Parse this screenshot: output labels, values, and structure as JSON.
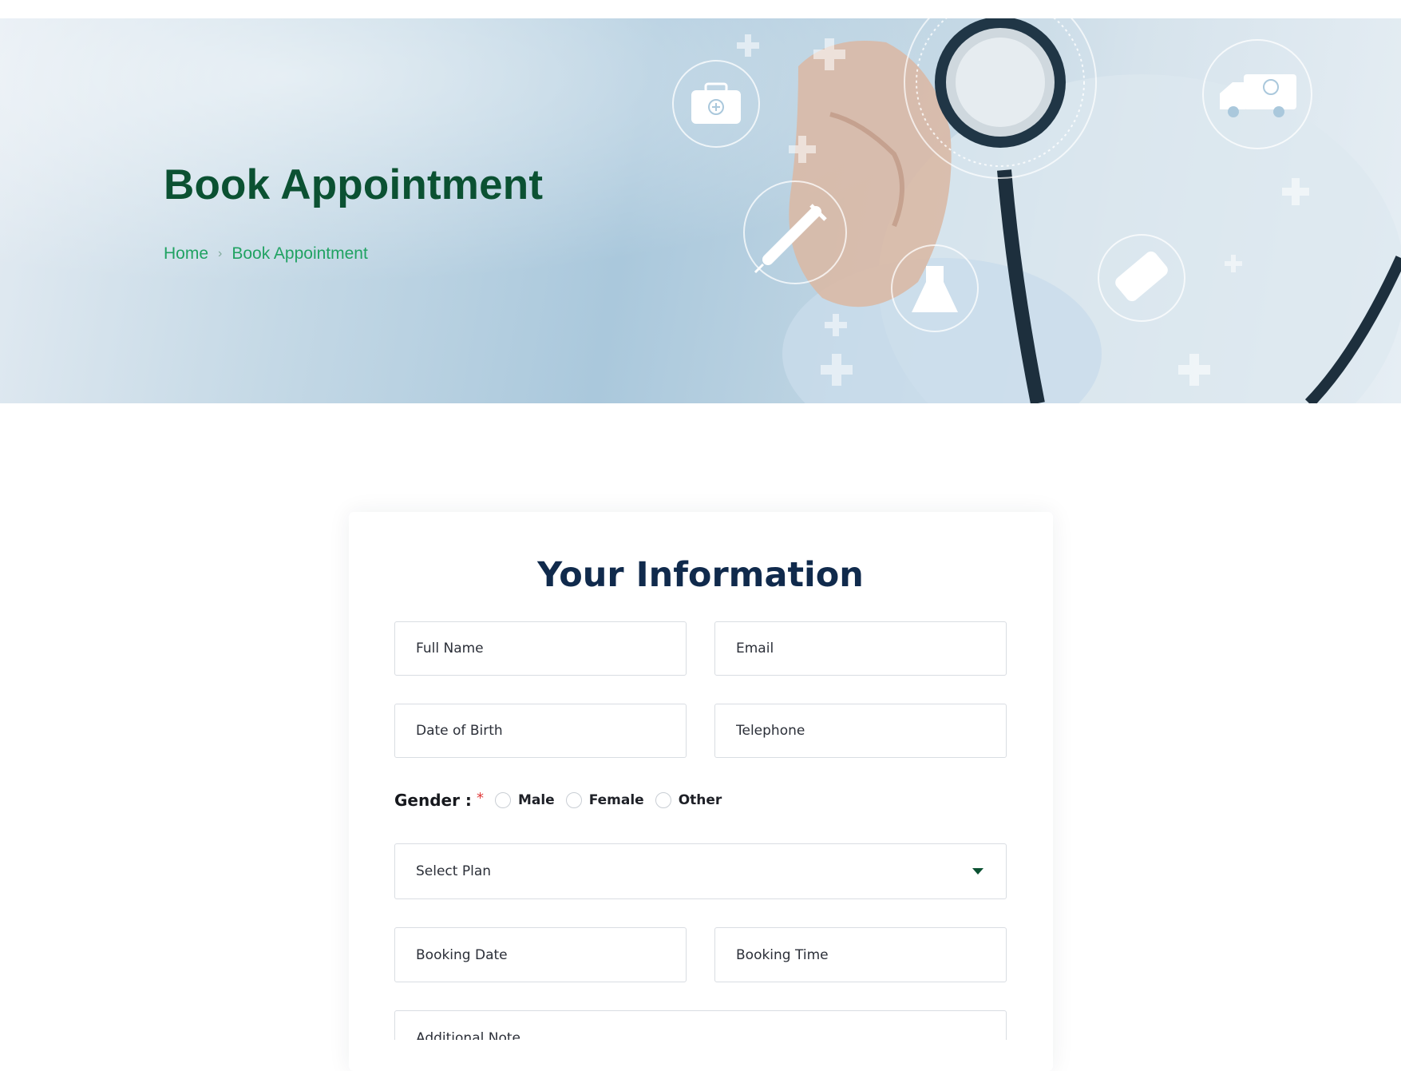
{
  "hero": {
    "title": "Book Appointment",
    "breadcrumb": {
      "home": "Home",
      "separator": "›",
      "current": "Book Appointment"
    },
    "icons": [
      "first-aid-kit-icon",
      "syringe-icon",
      "flask-icon",
      "stethoscope-icon",
      "pills-icon",
      "ambulance-icon",
      "plus-icon"
    ]
  },
  "form": {
    "title": "Your Information",
    "full_name_placeholder": "Full Name",
    "email_placeholder": "Email",
    "dob_placeholder": "Date of Birth",
    "telephone_placeholder": "Telephone",
    "gender": {
      "label": "Gender :",
      "required_mark": "*",
      "options": [
        "Male",
        "Female",
        "Other"
      ]
    },
    "plan": {
      "selected": "Select Plan"
    },
    "booking_date_placeholder": "Booking Date",
    "booking_time_placeholder": "Booking Time",
    "note_placeholder": "Additional Note"
  },
  "colors": {
    "title_green": "#0b5132",
    "breadcrumb_green": "#20a262",
    "form_title_navy": "#102a4c",
    "required_red": "#e03a3a"
  }
}
